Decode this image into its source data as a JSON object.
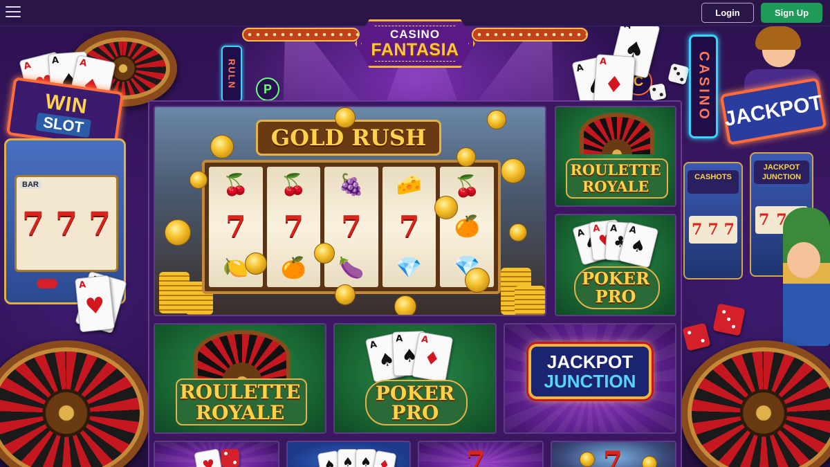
{
  "header": {
    "menu_icon": "hamburger-menu-icon",
    "logo_line1": "CASINO",
    "logo_line2": "FANTASIA",
    "login_label": "Login",
    "signup_label": "Sign Up"
  },
  "decor": {
    "sign_win_line1": "WIN",
    "sign_win_line2": "SLOT",
    "sign_jackpot": "JACKPOT",
    "neon_casino": "CASINO",
    "neon_roul": "RULN",
    "neon_p": "P",
    "neon_c": "C",
    "left_slot_reel": "7",
    "left_slot_bar": "BAR",
    "mini_slot_1": "CASHOTS",
    "mini_slot_2": "JACKPOT JUNCTION",
    "mini_reel": "7"
  },
  "featured": {
    "title": "GOLD RUSH",
    "reels": [
      [
        "🍒",
        "7",
        "🍋"
      ],
      [
        "🍒",
        "7",
        "🍊"
      ],
      [
        "🍇",
        "7",
        "🍆"
      ],
      [
        "🧀",
        "7",
        "💎"
      ],
      [
        "🍒",
        "🍊",
        "💎"
      ]
    ]
  },
  "games": [
    {
      "line1": "ROULETTE",
      "line2": "ROYALE"
    },
    {
      "line1": "POKER",
      "line2": "PRO"
    },
    {
      "line1": "ROULETTE",
      "line2": "ROYALE"
    },
    {
      "line1": "POKER",
      "line2": "PRO"
    },
    {
      "line1": "JACKPOT",
      "line2": "JUNCTION"
    }
  ],
  "card_ranks": [
    "A",
    "A",
    "A"
  ],
  "card_suits": [
    "♠",
    "♦",
    "♠"
  ],
  "colors": {
    "accent_gold": "#ffd24a",
    "signup_green": "#1e9a5a",
    "nav_bg": "#2a1548",
    "frame_purple": "#3b1760"
  }
}
